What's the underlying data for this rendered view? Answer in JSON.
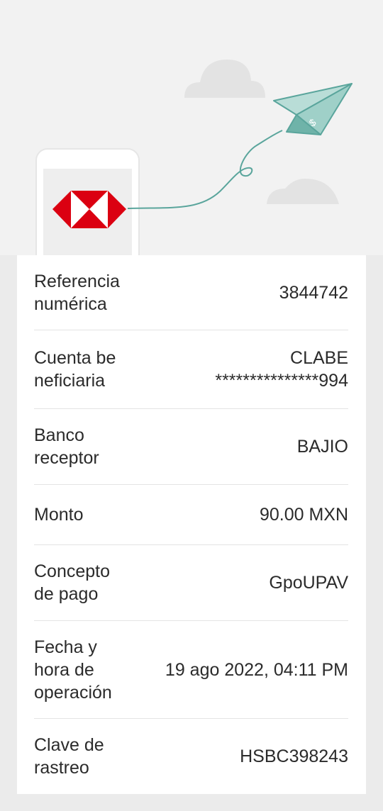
{
  "rows": [
    {
      "label": "Referencia\nnumérica",
      "value": "3844742"
    },
    {
      "label": "Cuenta be\nneficiaria",
      "value": "CLABE\n***************994"
    },
    {
      "label": "Banco\nreceptor",
      "value": "BAJIO"
    },
    {
      "label": "Monto",
      "value": "90.00 MXN"
    },
    {
      "label": "Concepto\nde pago",
      "value": "GpoUPAV"
    },
    {
      "label": "Fecha y\nhora de\noperación",
      "value": "19 ago 2022, 04:11 PM"
    },
    {
      "label": "Clave de\nrastreo",
      "value": "HSBC398243"
    }
  ],
  "colors": {
    "brand_red": "#db0011",
    "plane_teal": "#5aa59c",
    "card_bg": "#ffffff",
    "page_bg": "#ebebeb",
    "hero_bg": "#f2f2f2"
  },
  "hero": {
    "logo_icon": "hsbc-hexagon-logo",
    "plane_icon": "paper-plane-money-icon",
    "plane_symbol": "$"
  }
}
